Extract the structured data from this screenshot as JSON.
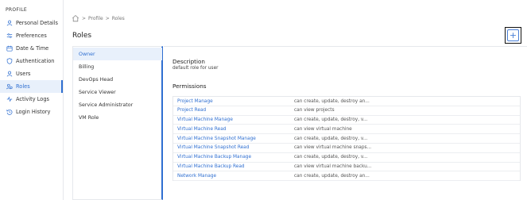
{
  "sidebar": {
    "title": "PROFILE",
    "items": [
      {
        "label": "Personal Details",
        "icon": "user-icon"
      },
      {
        "label": "Preferences",
        "icon": "sliders-icon"
      },
      {
        "label": "Date & Time",
        "icon": "calendar-icon"
      },
      {
        "label": "Authentication",
        "icon": "shield-icon"
      },
      {
        "label": "Users",
        "icon": "users-icon"
      },
      {
        "label": "Roles",
        "icon": "roles-icon"
      },
      {
        "label": "Activity Logs",
        "icon": "activity-icon"
      },
      {
        "label": "Login History",
        "icon": "history-icon"
      }
    ],
    "active_index": 5
  },
  "breadcrumb": {
    "separator": ">",
    "items": [
      "Profile",
      "Roles"
    ]
  },
  "page": {
    "title": "Roles",
    "add_button_label": "+"
  },
  "roles": {
    "items": [
      "Owner",
      "Billing",
      "DevOps Head",
      "Service Viewer",
      "Service Administrator",
      "VM Role"
    ],
    "active_index": 0
  },
  "detail": {
    "description_label": "Description",
    "description_value": "default role for user",
    "permissions_label": "Permissions",
    "permissions": [
      {
        "name": "Project Manage",
        "desc": "can create, update, destroy an..."
      },
      {
        "name": "Project Read",
        "desc": "can view projects"
      },
      {
        "name": "Virtual Machine Manage",
        "desc": "can create, update, destroy, v..."
      },
      {
        "name": "Virtual Machine Read",
        "desc": "can view virtual machine"
      },
      {
        "name": "Virtual Machine Snapshot Manage",
        "desc": "can create, update, destroy, v..."
      },
      {
        "name": "Virtual Machine Snapshot Read",
        "desc": "can view virtual machine snaps..."
      },
      {
        "name": "Virtual Machine Backup Manage",
        "desc": "can create, update, destroy, v..."
      },
      {
        "name": "Virtual Machine Backup Read",
        "desc": "can view virtual machine backu..."
      },
      {
        "name": "Network Manage",
        "desc": "can create, update, destroy an..."
      }
    ]
  },
  "colors": {
    "accent": "#2f6fd1",
    "active_bg": "#e8f0fb",
    "border": "#e6e8ec"
  }
}
